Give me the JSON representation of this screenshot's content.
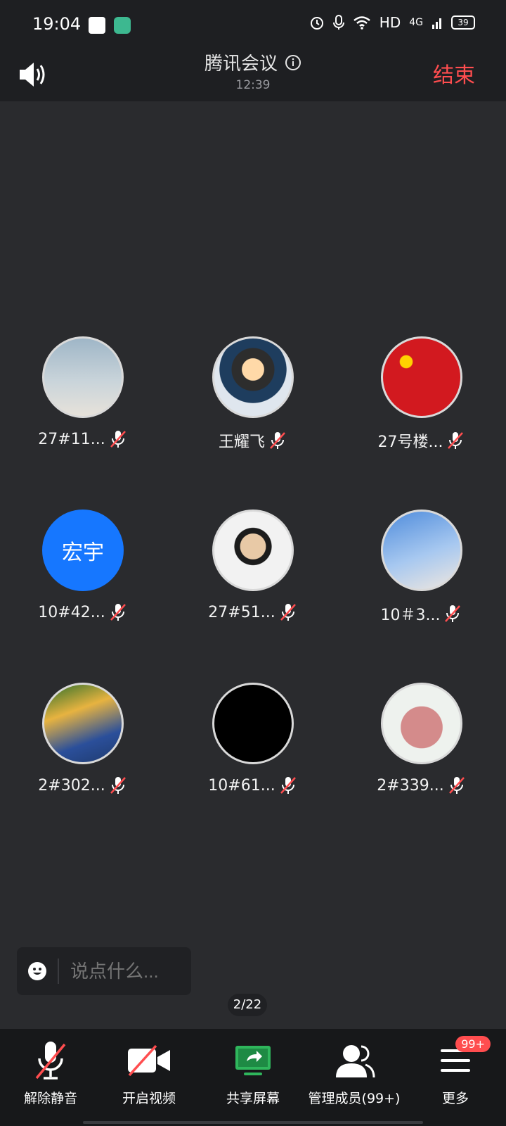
{
  "status_bar": {
    "time": "19:04",
    "signal_labels": [
      "HD",
      "4G"
    ],
    "battery": "39"
  },
  "header": {
    "title": "腾讯会议",
    "duration": "12:39",
    "end_label": "结束"
  },
  "members": [
    {
      "name": "27#11...",
      "avatar_text": "",
      "avatar_kind": "photo1"
    },
    {
      "name": "王耀飞",
      "avatar_text": "",
      "avatar_kind": "photo2"
    },
    {
      "name": "27号楼...",
      "avatar_text": "",
      "avatar_kind": "photo3"
    },
    {
      "name": "10#42...",
      "avatar_text": "宏宇",
      "avatar_kind": "blue"
    },
    {
      "name": "27#51...",
      "avatar_text": "",
      "avatar_kind": "photo4"
    },
    {
      "name": "10＃3...",
      "avatar_text": "",
      "avatar_kind": "photo5"
    },
    {
      "name": "2#302...",
      "avatar_text": "",
      "avatar_kind": "photo6"
    },
    {
      "name": "10#61...",
      "avatar_text": "",
      "avatar_kind": "black"
    },
    {
      "name": "2#339...",
      "avatar_text": "",
      "avatar_kind": "photo7"
    }
  ],
  "chat": {
    "placeholder": "说点什么..."
  },
  "page_indicator": "2/22",
  "toolbar": {
    "unmute_label": "解除静音",
    "video_label": "开启视频",
    "share_label": "共享屏幕",
    "members_label": "管理成员(99+)",
    "more_label": "更多",
    "more_badge": "99+"
  },
  "colors": {
    "background": "#2a2b2e",
    "end_button": "#ff4d4f",
    "avatar_blue": "#1677ff",
    "share_green": "#2fb65c"
  }
}
